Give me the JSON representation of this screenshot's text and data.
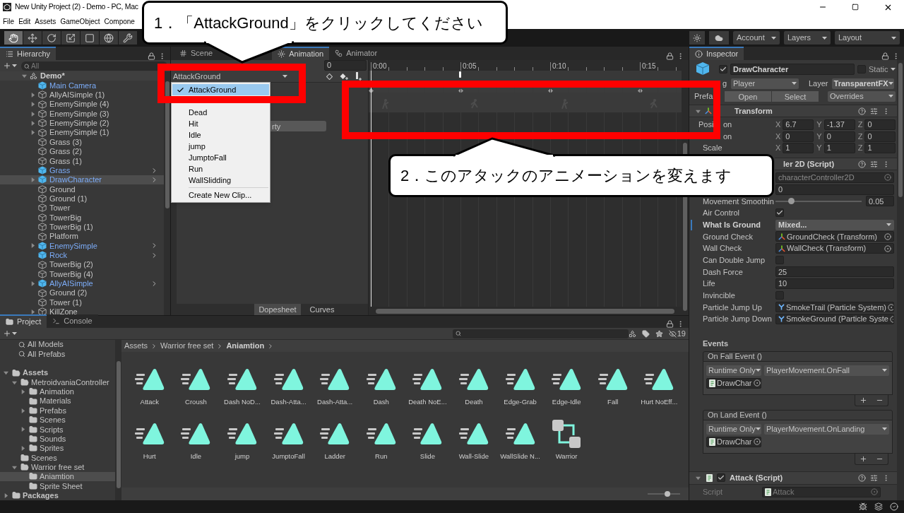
{
  "window": {
    "title": "New Unity Project (2) - Demo - PC, Mac"
  },
  "menu": [
    "File",
    "Edit",
    "Assets",
    "GameObject",
    "Compone"
  ],
  "toolbar": {
    "tools": [
      {
        "kind": "hand",
        "selected": true
      },
      {
        "kind": "move",
        "selected": false
      },
      {
        "kind": "rotate",
        "selected": false
      },
      {
        "kind": "scale",
        "selected": false
      },
      {
        "kind": "rect",
        "selected": false
      },
      {
        "kind": "transform",
        "selected": false
      },
      {
        "kind": "custom",
        "selected": false
      }
    ],
    "menus": [
      "Account",
      "Layers",
      "Layout"
    ]
  },
  "hierarchy": {
    "title": "Hierarchy",
    "search_placeholder": "All",
    "scene": {
      "name": "Demo*",
      "expanded": true,
      "selected": false,
      "children": [
        {
          "name": "Main Camera",
          "prefab": true,
          "chevron": false,
          "selected": false
        },
        {
          "name": "AllyAISimple (1)",
          "prefab": false,
          "chevron": false,
          "selected": false,
          "expanded": false
        },
        {
          "name": "EnemySimple (4)",
          "prefab": false,
          "chevron": false,
          "selected": false,
          "expanded": false
        },
        {
          "name": "EnemySimple (3)",
          "prefab": false,
          "chevron": false,
          "selected": false,
          "expanded": false
        },
        {
          "name": "EnemySimple (2)",
          "prefab": false,
          "chevron": false,
          "selected": false,
          "expanded": false
        },
        {
          "name": "EnemySimple (1)",
          "prefab": false,
          "chevron": false,
          "selected": false,
          "expanded": false
        },
        {
          "name": "Grass (3)",
          "prefab": false,
          "chevron": false,
          "selected": false
        },
        {
          "name": "Grass (2)",
          "prefab": false,
          "chevron": false,
          "selected": false
        },
        {
          "name": "Grass (1)",
          "prefab": false,
          "chevron": false,
          "selected": false
        },
        {
          "name": "Grass",
          "prefab": true,
          "chevron": true,
          "selected": false
        },
        {
          "name": "DrawCharacter",
          "prefab": true,
          "chevron": true,
          "selected": true,
          "expanded": false
        },
        {
          "name": "Ground",
          "prefab": false,
          "chevron": false,
          "selected": false
        },
        {
          "name": "Ground (1)",
          "prefab": false,
          "chevron": false,
          "selected": false
        },
        {
          "name": "Tower",
          "prefab": false,
          "chevron": false,
          "selected": false
        },
        {
          "name": "TowerBig",
          "prefab": false,
          "chevron": false,
          "selected": false
        },
        {
          "name": "TowerBig (1)",
          "prefab": false,
          "chevron": false,
          "selected": false
        },
        {
          "name": "Platform",
          "prefab": false,
          "chevron": false,
          "selected": false
        },
        {
          "name": "EnemySimple",
          "prefab": true,
          "chevron": true,
          "selected": false,
          "expanded": false
        },
        {
          "name": "Rock",
          "prefab": true,
          "chevron": true,
          "selected": false
        },
        {
          "name": "TowerBig (2)",
          "prefab": false,
          "chevron": false,
          "selected": false
        },
        {
          "name": "TowerBig (4)",
          "prefab": false,
          "chevron": false,
          "selected": false
        },
        {
          "name": "AllyAISimple",
          "prefab": true,
          "chevron": true,
          "selected": false,
          "expanded": false
        },
        {
          "name": "Ground (2)",
          "prefab": false,
          "chevron": false,
          "selected": false
        },
        {
          "name": "Tower (1)",
          "prefab": false,
          "chevron": false,
          "selected": false
        },
        {
          "name": "KillZone",
          "prefab": false,
          "chevron": false,
          "selected": false,
          "expanded": false
        }
      ]
    }
  },
  "animation": {
    "tabs": [
      {
        "label": "Scene",
        "kind": "scene",
        "selected": false
      },
      {
        "label": "Animation",
        "kind": "animation",
        "selected": true
      },
      {
        "label": "Animator",
        "kind": "animator",
        "selected": false
      }
    ],
    "frame": "0",
    "clip": "AttackGround",
    "add_property": "rty",
    "ruler": [
      "0:00",
      "0:05",
      "0:10",
      "0:15"
    ],
    "view_tabs": [
      {
        "label": "Dopesheet",
        "selected": true
      },
      {
        "label": "Curves",
        "selected": false
      }
    ],
    "clip_menu": {
      "items": [
        {
          "label": "AttackGround",
          "selected": true
        },
        {
          "label": "Dead",
          "selected": false
        },
        {
          "label": "Hit",
          "selected": false
        },
        {
          "label": "Idle",
          "selected": false
        },
        {
          "label": "jump",
          "selected": false
        },
        {
          "label": "JumptoFall",
          "selected": false
        },
        {
          "label": "Run",
          "selected": false
        },
        {
          "label": "WallSlidding",
          "selected": false
        }
      ],
      "footer": "Create New Clip..."
    }
  },
  "inspector": {
    "title": "Inspector",
    "object": {
      "active": true,
      "name": "DrawCharacter",
      "static": false,
      "static_label": "Static",
      "tag_label": "g",
      "tag": "Player",
      "layer_label": "Layer",
      "layer": "TransparentFX",
      "prefab_label": "Prefa",
      "prefab_buttons": [
        "Open",
        "Select"
      ],
      "overrides": "Overrides"
    },
    "transform": {
      "title": "Transform",
      "expanded": true,
      "rows": [
        {
          "label_parts": [
            "Posi",
            "on"
          ],
          "values": [
            {
              "axis": "X",
              "value": "6.7"
            },
            {
              "axis": "Y",
              "value": "-1.37"
            },
            {
              "axis": "Z",
              "value": "0"
            }
          ]
        },
        {
          "label_parts": [
            "on"
          ],
          "values": [
            {
              "axis": "X",
              "value": "0"
            },
            {
              "axis": "Y",
              "value": "0"
            },
            {
              "axis": "Z",
              "value": "0"
            }
          ]
        },
        {
          "label_parts": [
            "Scale"
          ],
          "values": [
            {
              "axis": "X",
              "value": "1"
            },
            {
              "axis": "Y",
              "value": "1"
            },
            {
              "axis": "Z",
              "value": "1"
            }
          ]
        }
      ]
    },
    "controller": {
      "title": "ler 2D (Script)",
      "fields": [
        {
          "kind": "object",
          "value": "characterController2D",
          "disabled": true
        },
        {
          "kind": "text",
          "value": "0"
        },
        {
          "kind": "slider",
          "label": "Movement Smoothin",
          "level": 0.18,
          "value": "0.05"
        },
        {
          "kind": "checkbox",
          "label": "Air Control",
          "checked": true
        },
        {
          "kind": "dropdown",
          "label": "What Is Ground",
          "value": "Mixed...",
          "modified": true
        },
        {
          "kind": "transform-object",
          "label": "Ground Check",
          "value": "GroundCheck (Transform)",
          "disabled": false
        },
        {
          "kind": "transform-object",
          "label": "Wall Check",
          "value": "WallCheck (Transform)",
          "disabled": false
        },
        {
          "kind": "checkbox",
          "label": "Can Double Jump",
          "checked": false
        },
        {
          "kind": "text",
          "label": "Dash Force",
          "value": "25"
        },
        {
          "kind": "text",
          "label": "Life",
          "value": "10"
        },
        {
          "kind": "checkbox",
          "label": "Invincible",
          "checked": false
        },
        {
          "kind": "particle-object",
          "label": "Particle Jump Up",
          "value": "SmokeTrail (Particle System)",
          "disabled": false
        },
        {
          "kind": "particle-object",
          "label": "Particle Jump Down",
          "value": "SmokeGround (Particle Syste",
          "disabled": false
        }
      ],
      "events_label": "Events",
      "events": [
        {
          "title": "On Fall Event ()",
          "mode": "Runtime Only",
          "target": "DrawChar",
          "method": "PlayerMovement.OnFall"
        },
        {
          "title": "On Land Event ()",
          "mode": "Runtime Only",
          "target": "DrawChar",
          "method": "PlayerMovement.OnLanding"
        }
      ]
    },
    "attack": {
      "title": "Attack (Script)",
      "enabled": true,
      "expanded": true,
      "fields": [
        {
          "label": "Script",
          "value": "Attack",
          "disabled": true
        }
      ]
    }
  },
  "project": {
    "tabs": [
      {
        "label": "Project",
        "kind": "project",
        "selected": true
      },
      {
        "label": "Console",
        "kind": "console",
        "selected": false
      }
    ],
    "hidden_count": "19",
    "favorites": [
      "All Models",
      "All Prefabs"
    ],
    "tree": [
      {
        "name": "Assets",
        "expanded": true,
        "selected": false,
        "children": [
          {
            "name": "MetroidvaniaController",
            "expanded": true,
            "selected": false,
            "children": [
              {
                "name": "Animation",
                "expanded": false,
                "selected": false
              },
              {
                "name": "Materials",
                "selected": false
              },
              {
                "name": "Prefabs",
                "expanded": false,
                "selected": false
              },
              {
                "name": "Scenes",
                "selected": false
              },
              {
                "name": "Scripts",
                "expanded": false,
                "selected": false
              },
              {
                "name": "Sounds",
                "selected": false
              },
              {
                "name": "Sprites",
                "expanded": false,
                "selected": false
              }
            ]
          },
          {
            "name": "Scenes",
            "selected": false
          },
          {
            "name": "Warrior free set",
            "expanded": true,
            "selected": false,
            "children": [
              {
                "name": "Aniamtion",
                "selected": true
              },
              {
                "name": "Sprite Sheet",
                "selected": false
              }
            ]
          }
        ]
      },
      {
        "name": "Packages",
        "expanded": false,
        "selected": false
      }
    ],
    "breadcrumb": [
      "Assets",
      "Warrior free set",
      "Aniamtion"
    ],
    "assets": [
      {
        "name": "Attack",
        "kind": "clip"
      },
      {
        "name": "Croush",
        "kind": "clip"
      },
      {
        "name": "Dash NoD...",
        "kind": "clip"
      },
      {
        "name": "Dash-Atta...",
        "kind": "clip"
      },
      {
        "name": "Dash-Atta...",
        "kind": "clip"
      },
      {
        "name": "Dash",
        "kind": "clip"
      },
      {
        "name": "Death NoE...",
        "kind": "clip"
      },
      {
        "name": "Death",
        "kind": "clip"
      },
      {
        "name": "Edge-Grab",
        "kind": "clip"
      },
      {
        "name": "Edge-Idle",
        "kind": "clip"
      },
      {
        "name": "Fall",
        "kind": "clip"
      },
      {
        "name": "Hurt NoEff...",
        "kind": "clip"
      },
      {
        "name": "Hurt",
        "kind": "clip"
      },
      {
        "name": "Idle",
        "kind": "clip"
      },
      {
        "name": "jump",
        "kind": "clip"
      },
      {
        "name": "JumptoFall",
        "kind": "clip"
      },
      {
        "name": "Ladder",
        "kind": "clip"
      },
      {
        "name": "Run",
        "kind": "clip"
      },
      {
        "name": "Slide",
        "kind": "clip"
      },
      {
        "name": "Wall-Slide",
        "kind": "clip"
      },
      {
        "name": "WallSlide N...",
        "kind": "clip"
      },
      {
        "name": "Warrior",
        "kind": "controller"
      }
    ],
    "icon_size": {
      "level": 0.6
    }
  },
  "callouts": [
    {
      "text": "1．「AttackGround」をクリックしてください"
    },
    {
      "text": "2．このアタックのアニメーションを変えます"
    }
  ]
}
